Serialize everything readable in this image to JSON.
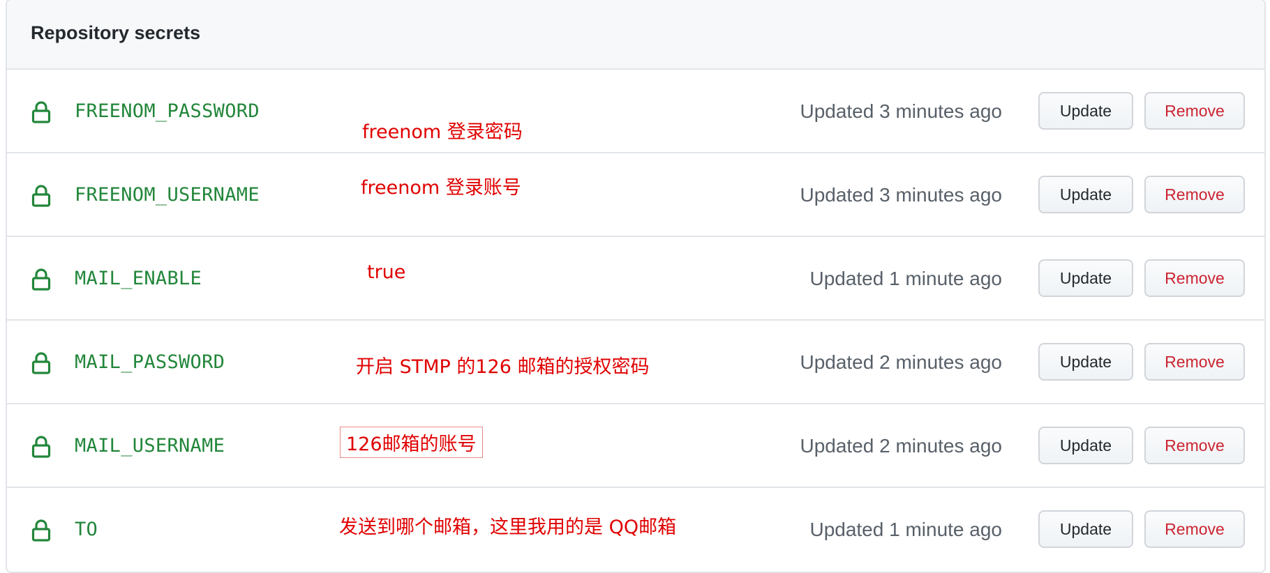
{
  "header": {
    "title": "Repository secrets"
  },
  "secrets": [
    {
      "name": "FREENOM_PASSWORD",
      "annotation": "freenom 登录密码",
      "updated": "Updated 3 minutes ago",
      "update_label": "Update",
      "remove_label": "Remove"
    },
    {
      "name": "FREENOM_USERNAME",
      "annotation": "freenom 登录账号",
      "updated": "Updated 3 minutes ago",
      "update_label": "Update",
      "remove_label": "Remove"
    },
    {
      "name": "MAIL_ENABLE",
      "annotation": "true",
      "updated": "Updated 1 minute ago",
      "update_label": "Update",
      "remove_label": "Remove"
    },
    {
      "name": "MAIL_PASSWORD",
      "annotation": "开启 STMP 的126 邮箱的授权密码",
      "updated": "Updated 2 minutes ago",
      "update_label": "Update",
      "remove_label": "Remove"
    },
    {
      "name": "MAIL_USERNAME",
      "annotation": "126邮箱的账号",
      "updated": "Updated 2 minutes ago",
      "update_label": "Update",
      "remove_label": "Remove"
    },
    {
      "name": "TO",
      "annotation": "发送到哪个邮箱，这里我用的是 QQ邮箱",
      "updated": "Updated 1 minute ago",
      "update_label": "Update",
      "remove_label": "Remove"
    }
  ],
  "colors": {
    "secret_name": "#22863a",
    "annotation": "#e00000",
    "remove_text": "#cb2431",
    "updated_text": "#586069"
  },
  "icons": {
    "secret_icon": "lock-icon"
  }
}
